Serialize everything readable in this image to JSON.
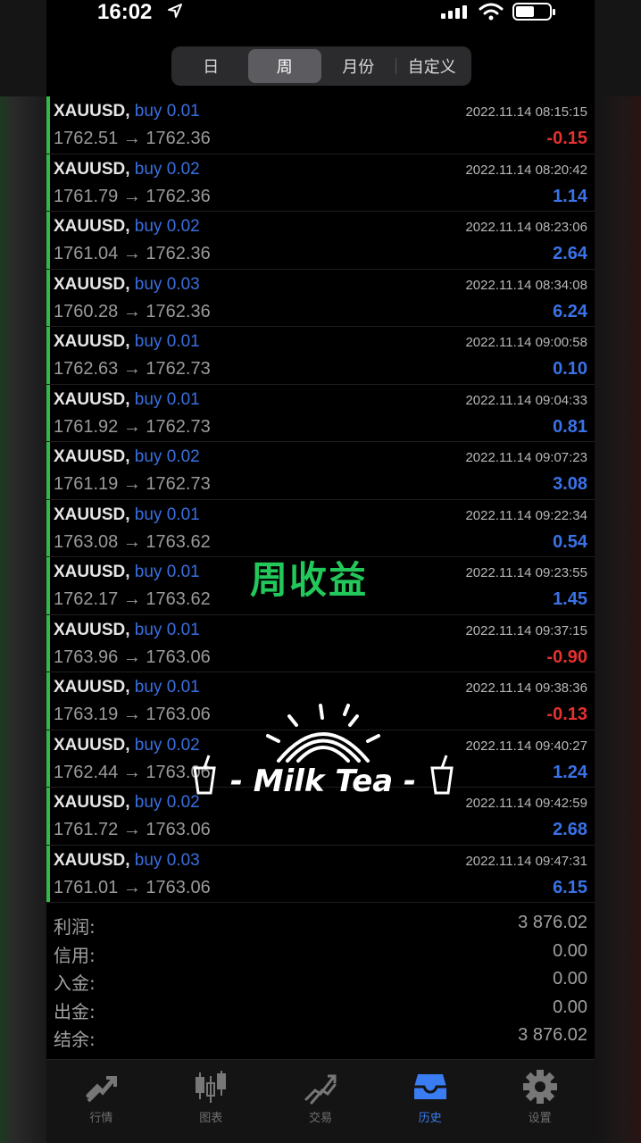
{
  "status_bar": {
    "time": "16:02"
  },
  "period_tabs": [
    {
      "label": "日",
      "active": false
    },
    {
      "label": "周",
      "active": true
    },
    {
      "label": "月份",
      "active": false
    },
    {
      "label": "自定义",
      "active": false
    }
  ],
  "trades": [
    {
      "symbol": "XAUUSD,",
      "side": "buy",
      "volume": "0.01",
      "open": "1762.51",
      "close": "1762.36",
      "time": "2022.11.14 08:15:15",
      "profit": "-0.15"
    },
    {
      "symbol": "XAUUSD,",
      "side": "buy",
      "volume": "0.02",
      "open": "1761.79",
      "close": "1762.36",
      "time": "2022.11.14 08:20:42",
      "profit": "1.14"
    },
    {
      "symbol": "XAUUSD,",
      "side": "buy",
      "volume": "0.02",
      "open": "1761.04",
      "close": "1762.36",
      "time": "2022.11.14 08:23:06",
      "profit": "2.64"
    },
    {
      "symbol": "XAUUSD,",
      "side": "buy",
      "volume": "0.03",
      "open": "1760.28",
      "close": "1762.36",
      "time": "2022.11.14 08:34:08",
      "profit": "6.24"
    },
    {
      "symbol": "XAUUSD,",
      "side": "buy",
      "volume": "0.01",
      "open": "1762.63",
      "close": "1762.73",
      "time": "2022.11.14 09:00:58",
      "profit": "0.10"
    },
    {
      "symbol": "XAUUSD,",
      "side": "buy",
      "volume": "0.01",
      "open": "1761.92",
      "close": "1762.73",
      "time": "2022.11.14 09:04:33",
      "profit": "0.81"
    },
    {
      "symbol": "XAUUSD,",
      "side": "buy",
      "volume": "0.02",
      "open": "1761.19",
      "close": "1762.73",
      "time": "2022.11.14 09:07:23",
      "profit": "3.08"
    },
    {
      "symbol": "XAUUSD,",
      "side": "buy",
      "volume": "0.01",
      "open": "1763.08",
      "close": "1763.62",
      "time": "2022.11.14 09:22:34",
      "profit": "0.54"
    },
    {
      "symbol": "XAUUSD,",
      "side": "buy",
      "volume": "0.01",
      "open": "1762.17",
      "close": "1763.62",
      "time": "2022.11.14 09:23:55",
      "profit": "1.45"
    },
    {
      "symbol": "XAUUSD,",
      "side": "buy",
      "volume": "0.01",
      "open": "1763.96",
      "close": "1763.06",
      "time": "2022.11.14 09:37:15",
      "profit": "-0.90"
    },
    {
      "symbol": "XAUUSD,",
      "side": "buy",
      "volume": "0.01",
      "open": "1763.19",
      "close": "1763.06",
      "time": "2022.11.14 09:38:36",
      "profit": "-0.13"
    },
    {
      "symbol": "XAUUSD,",
      "side": "buy",
      "volume": "0.02",
      "open": "1762.44",
      "close": "1763.06",
      "time": "2022.11.14 09:40:27",
      "profit": "1.24"
    },
    {
      "symbol": "XAUUSD,",
      "side": "buy",
      "volume": "0.02",
      "open": "1761.72",
      "close": "1763.06",
      "time": "2022.11.14 09:42:59",
      "profit": "2.68"
    },
    {
      "symbol": "XAUUSD,",
      "side": "buy",
      "volume": "0.03",
      "open": "1761.01",
      "close": "1763.06",
      "time": "2022.11.14 09:47:31",
      "profit": "6.15"
    }
  ],
  "arrow": "→",
  "summary": [
    {
      "label": "利润:",
      "value": "3 876.02"
    },
    {
      "label": "信用:",
      "value": "0.00"
    },
    {
      "label": "入金:",
      "value": "0.00"
    },
    {
      "label": "出金:",
      "value": "0.00"
    },
    {
      "label": "结余:",
      "value": "3 876.02"
    }
  ],
  "overlay": {
    "title": "周收益",
    "sticker_text": "- Milk Tea -"
  },
  "colors": {
    "profit_positive": "#3a72e8",
    "profit_negative": "#e5312f",
    "accent_green": "#33b84a",
    "active_tab": "#3a7cf2"
  },
  "tab_bar": [
    {
      "label": "行情",
      "icon": "quotes-icon",
      "active": false
    },
    {
      "label": "图表",
      "icon": "chart-icon",
      "active": false
    },
    {
      "label": "交易",
      "icon": "trade-icon",
      "active": false
    },
    {
      "label": "历史",
      "icon": "history-icon",
      "active": true
    },
    {
      "label": "设置",
      "icon": "settings-icon",
      "active": false
    }
  ]
}
